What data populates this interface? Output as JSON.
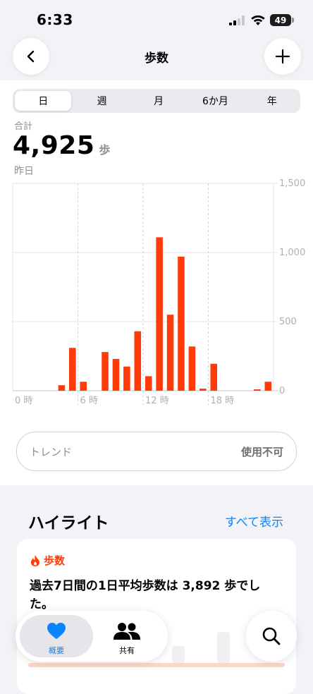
{
  "status": {
    "time": "6:33",
    "battery": "49"
  },
  "nav": {
    "title": "歩数"
  },
  "segments": [
    "日",
    "週",
    "月",
    "6か月",
    "年"
  ],
  "summary": {
    "label": "合計",
    "value": "4,925",
    "unit": "歩",
    "date": "昨日"
  },
  "chart_data": {
    "type": "bar",
    "x": [
      0,
      1,
      2,
      3,
      4,
      5,
      6,
      7,
      8,
      9,
      10,
      11,
      12,
      13,
      14,
      15,
      16,
      17,
      18,
      19,
      20,
      21,
      22,
      23
    ],
    "xticks": [
      "0 時",
      "6 時",
      "12 時",
      "18 時"
    ],
    "values": [
      0,
      0,
      0,
      0,
      40,
      310,
      65,
      0,
      280,
      230,
      175,
      430,
      105,
      1110,
      550,
      970,
      320,
      15,
      195,
      0,
      0,
      0,
      10,
      65
    ],
    "yticks": [
      "1,500",
      "1,000",
      "500",
      "0"
    ],
    "ylim": [
      0,
      1500
    ],
    "color": "#ff3b0a"
  },
  "trend": {
    "label": "トレンド",
    "value": "使用不可"
  },
  "highlights": {
    "title": "ハイライト",
    "link": "すべて表示",
    "card": {
      "category": "歩数",
      "text": "過去7日間の1日平均歩数は 3,892 歩でした。"
    }
  },
  "tabbar": {
    "summary": "概要",
    "sharing": "共有"
  }
}
